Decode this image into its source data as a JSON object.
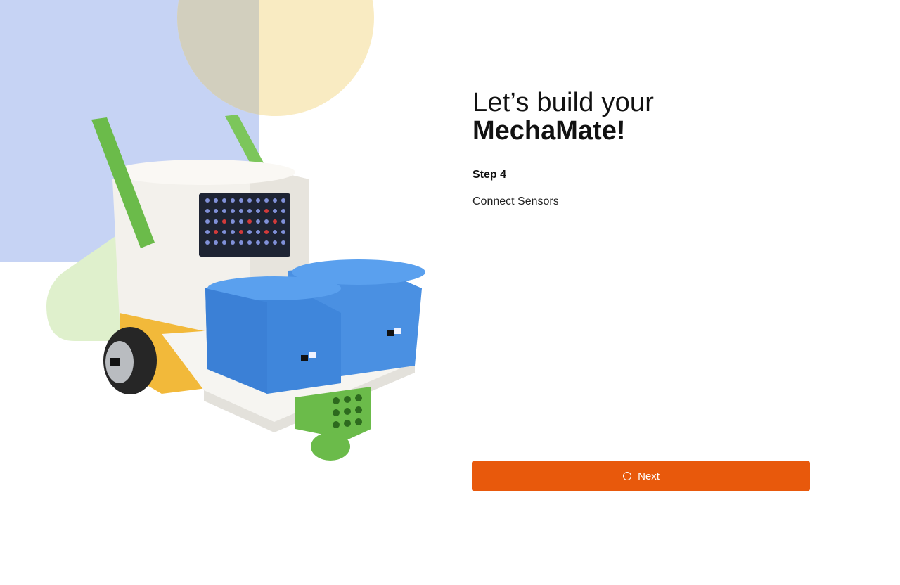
{
  "heading": {
    "line1": "Let’s build your",
    "line2": "MechaMate!"
  },
  "step": {
    "label": "Step 4",
    "description": "Connect Sensors"
  },
  "actions": {
    "next_label": "Next"
  },
  "colors": {
    "accent": "#e8590c",
    "bg_blue": "#c6d3f4",
    "bg_yellow": "#f9ebc2",
    "bg_green": "#dff0cc"
  },
  "icons": {
    "next_button_icon": "circle-outline-icon"
  },
  "illustration": {
    "subject": "robot-illustration"
  }
}
